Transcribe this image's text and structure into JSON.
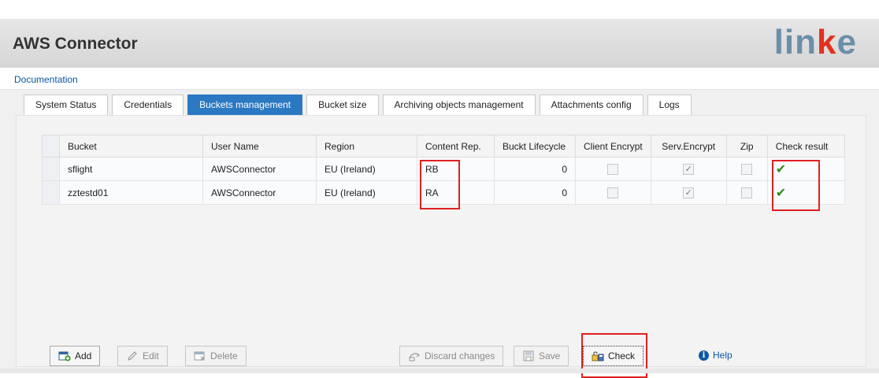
{
  "app": {
    "title": "AWS Connector",
    "logo": "linke"
  },
  "documentation_link": "Documentation",
  "tabs": [
    {
      "label": "System Status",
      "active": false
    },
    {
      "label": "Credentials",
      "active": false
    },
    {
      "label": "Buckets management",
      "active": true
    },
    {
      "label": "Bucket size",
      "active": false
    },
    {
      "label": "Archiving objects management",
      "active": false
    },
    {
      "label": "Attachments config",
      "active": false
    },
    {
      "label": "Logs",
      "active": false
    }
  ],
  "table": {
    "columns": [
      "Bucket",
      "User Name",
      "Region",
      "Content Rep.",
      "Buckt Lifecycle",
      "Client Encrypt",
      "Serv.Encrypt",
      "Zip",
      "Check result"
    ],
    "rows": [
      {
        "bucket": "sflight",
        "user": "AWSConnector",
        "region": "EU (Ireland)",
        "content_rep": "RB",
        "lifecycle": "0",
        "client_encrypt": false,
        "serv_encrypt": true,
        "zip": false,
        "check_result": "✔"
      },
      {
        "bucket": "zztestd01",
        "user": "AWSConnector",
        "region": "EU (Ireland)",
        "content_rep": "RA",
        "lifecycle": "0",
        "client_encrypt": false,
        "serv_encrypt": true,
        "zip": false,
        "check_result": "✔"
      }
    ]
  },
  "buttons": {
    "add": "Add",
    "edit": "Edit",
    "delete": "Delete",
    "discard": "Discard changes",
    "save": "Save",
    "check": "Check",
    "help": "Help"
  },
  "colors": {
    "active_tab": "#2b79c2",
    "highlight": "#e02020",
    "link": "#0b57a4",
    "check_ok": "#2f8a1a"
  },
  "icons": {
    "add": "add-icon",
    "edit": "pencil-icon",
    "delete": "delete-icon",
    "discard": "discard-icon",
    "save": "save-icon",
    "check": "check-icon",
    "help": "info-icon"
  }
}
